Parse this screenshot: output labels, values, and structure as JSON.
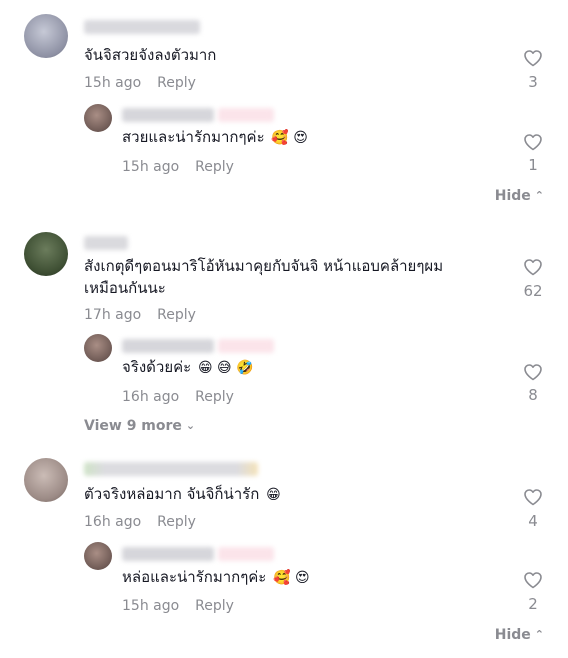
{
  "comments": [
    {
      "text": "จันจิสวยจังลงตัวมาก",
      "age": "15h ago",
      "reply_label": "Reply",
      "likes": "3",
      "replies": [
        {
          "text": "สวยและน่ารักมากๆค่ะ",
          "emoji": "🥰 😍",
          "age": "15h ago",
          "reply_label": "Reply",
          "likes": "1"
        }
      ],
      "hide_label": "Hide"
    },
    {
      "text_line1": "สังเกตุดีๆตอนมาริโอ้หันมาคุยกับจันจิ หน้าแอบคล้ายๆผม",
      "text_line2": "เหมือนกันนะ",
      "age": "17h ago",
      "reply_label": "Reply",
      "likes": "62",
      "replies": [
        {
          "text": "จริงด้วยค่ะ",
          "emoji": "😁 😅 🤣",
          "age": "16h ago",
          "reply_label": "Reply",
          "likes": "8"
        }
      ],
      "view_more_label": "View 9 more"
    },
    {
      "text": "ตัวจริงหล่อมาก จันจิก็น่ารัก",
      "emoji": "😁",
      "age": "16h ago",
      "reply_label": "Reply",
      "likes": "4",
      "replies": [
        {
          "text": "หล่อและน่ารักมากๆค่ะ",
          "emoji": "🥰 😍",
          "age": "15h ago",
          "reply_label": "Reply",
          "likes": "2"
        }
      ],
      "hide_label": "Hide"
    }
  ],
  "icons": {
    "like": "heart-outline-icon",
    "chevron_up": "chevron-up-icon",
    "chevron_down": "chevron-down-icon"
  },
  "colors": {
    "muted": "#8a8b91",
    "text": "#161823",
    "highlight_pink": "#fbe4ea"
  }
}
